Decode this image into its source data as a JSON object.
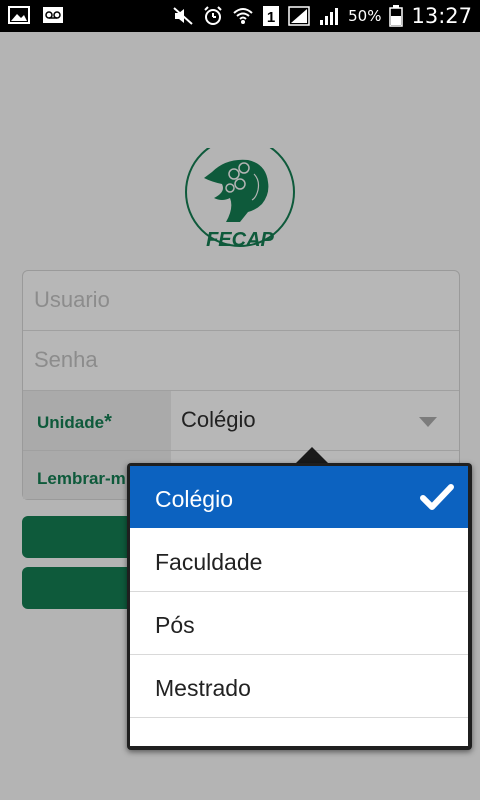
{
  "status_bar": {
    "battery_percent": "50%",
    "time": "13:27",
    "sim_slot": "1",
    "icons": [
      "image-icon",
      "voicemail-icon",
      "mute-icon",
      "alarm-icon",
      "wifi-icon",
      "sim-icon",
      "signal-icon",
      "battery-icon"
    ]
  },
  "logo": {
    "brand": "FECAP",
    "brand_color": "#0e5a3b"
  },
  "form": {
    "username_placeholder": "Usuario",
    "password_placeholder": "Senha",
    "unidade_label": "Unidade",
    "required_mark": "*",
    "unidade_value": "Colégio",
    "lembrar_label": "Lembrar-m"
  },
  "dropdown": {
    "options": [
      {
        "label": "Colégio",
        "selected": true
      },
      {
        "label": "Faculdade",
        "selected": false
      },
      {
        "label": "Pós",
        "selected": false
      },
      {
        "label": "Mestrado",
        "selected": false
      }
    ],
    "selected_color": "#0c62c0"
  }
}
